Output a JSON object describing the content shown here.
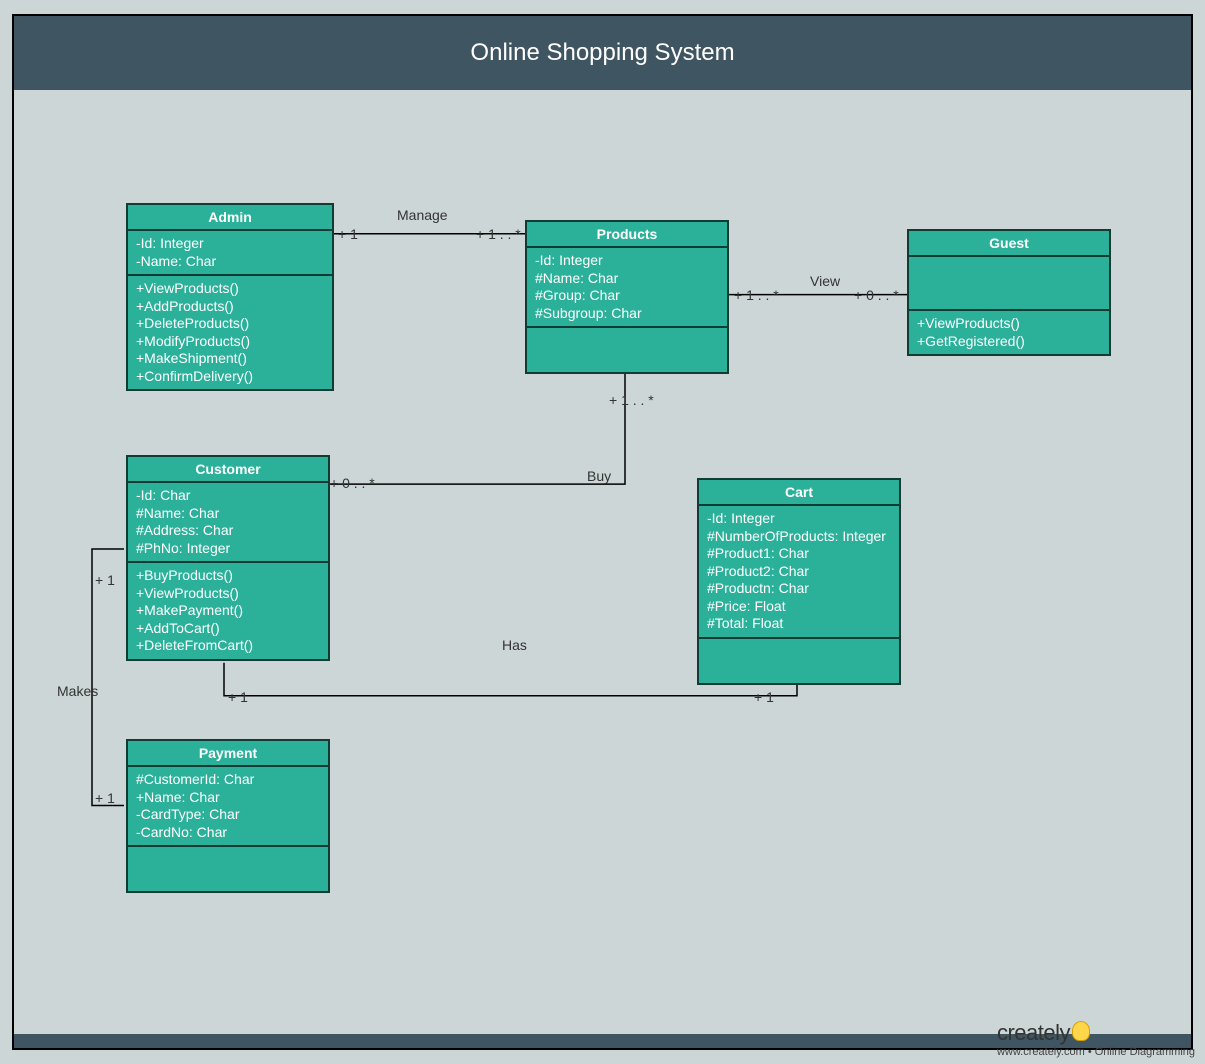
{
  "title": "Online Shopping System",
  "classes": {
    "admin": {
      "name": "Admin",
      "attrs": [
        "-Id: Integer",
        "-Name: Char"
      ],
      "ops": [
        "+ViewProducts()",
        "+AddProducts()",
        "+DeleteProducts()",
        "+ModifyProducts()",
        "+MakeShipment()",
        "+ConfirmDelivery()"
      ]
    },
    "products": {
      "name": "Products",
      "attrs": [
        "-Id: Integer",
        "#Name: Char",
        "#Group: Char",
        "#Subgroup: Char"
      ],
      "ops": []
    },
    "guest": {
      "name": "Guest",
      "attrs": [],
      "ops": [
        "+ViewProducts()",
        "+GetRegistered()"
      ]
    },
    "customer": {
      "name": "Customer",
      "attrs": [
        "-Id: Char",
        "#Name: Char",
        "#Address: Char",
        "#PhNo: Integer"
      ],
      "ops": [
        "+BuyProducts()",
        "+ViewProducts()",
        "+MakePayment()",
        "+AddToCart()",
        "+DeleteFromCart()"
      ]
    },
    "cart": {
      "name": "Cart",
      "attrs": [
        "-Id: Integer",
        "#NumberOfProducts: Integer",
        "#Product1: Char",
        "#Product2: Char",
        "#Productn: Char",
        "#Price: Float",
        "#Total: Float"
      ],
      "ops": []
    },
    "payment": {
      "name": "Payment",
      "attrs": [
        "#CustomerId: Char",
        "+Name: Char",
        "-CardType: Char",
        "-CardNo: Char"
      ],
      "ops": []
    }
  },
  "labels": {
    "manage": "Manage",
    "view": "View",
    "buy": "Buy",
    "has": "Has",
    "makes": "Makes"
  },
  "mult": {
    "admin_products_l": "+ 1",
    "admin_products_r": "+ 1 . . *",
    "products_guest_l": "+ 1 . . *",
    "products_guest_r": "+ 0 . . *",
    "products_customer_top": "+ 1 . . *",
    "products_customer_bot": "+ 0 . . *",
    "customer_cart_l": "+ 1",
    "customer_cart_r": "+ 1",
    "customer_payment_top": "+ 1",
    "customer_payment_bot": "+ 1"
  },
  "footer": {
    "brand": "creately",
    "tag": "www.creately.com • Online Diagramming"
  }
}
